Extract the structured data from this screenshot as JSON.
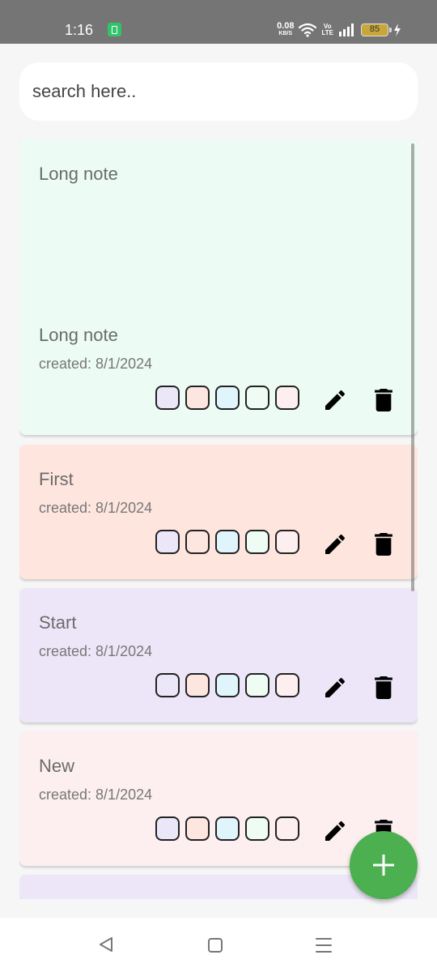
{
  "status_bar": {
    "time": "1:16",
    "net_speed_value": "0.08",
    "net_speed_unit": "KB/S",
    "volte_top": "Vo",
    "volte_bottom": "LTE",
    "battery_level": "85",
    "icons": [
      "app-notification-icon",
      "wifi-icon",
      "signal-icon",
      "battery-icon",
      "charging-icon"
    ]
  },
  "search": {
    "placeholder": "search here.."
  },
  "notes": [
    {
      "title": "Long note",
      "body": "Long note",
      "created_label": "created: 8/1/2024",
      "color": "#ecfcf4"
    },
    {
      "title": "First",
      "created_label": "created: 8/1/2024",
      "color": "#fee6df"
    },
    {
      "title": "Start",
      "created_label": "created: 8/1/2024",
      "color": "#ede6f8"
    },
    {
      "title": "New",
      "created_label": "created: 8/1/2024",
      "color": "#fdefef"
    }
  ],
  "partial_note": {
    "color": "#ede6f8"
  },
  "color_swatches": [
    "#ece6f9",
    "#fde6df",
    "#dff4fb",
    "#eefcf4",
    "#fdeff0"
  ],
  "colors": {
    "fab": "#4caf50",
    "status_bar": "#757575",
    "background": "#f6f6f6"
  }
}
